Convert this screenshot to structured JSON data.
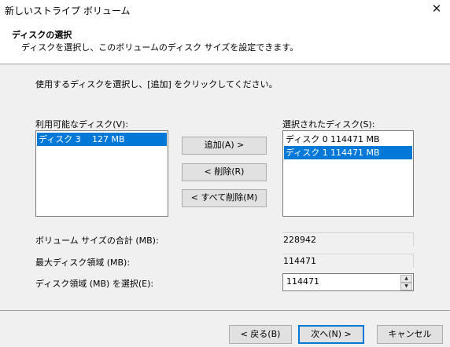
{
  "window": {
    "title": "新しいストライプ ボリューム",
    "close_glyph": "✕"
  },
  "header": {
    "title": "ディスクの選択",
    "subtitle": "ディスクを選択し、このボリュームのディスク サイズを設定できます。"
  },
  "instruction": "使用するディスクを選択し、[追加] をクリックしてください。",
  "available": {
    "label": "利用可能なディスク(V):",
    "items": [
      {
        "name": "ディスク 3",
        "size": "127 MB",
        "selected": true
      }
    ]
  },
  "selected_disks": {
    "label": "選択されたディスク(S):",
    "items": [
      {
        "name": "ディスク 0",
        "size": "114471 MB",
        "selected": false
      },
      {
        "name": "ディスク 1",
        "size": "114471 MB",
        "selected": true
      }
    ]
  },
  "buttons": {
    "add": "追加(A) >",
    "remove": "< 削除(R)",
    "remove_all": "< すべて削除(M)"
  },
  "fields": {
    "total_label": "ボリューム サイズの合計 (MB):",
    "total_value": "228942",
    "max_label": "最大ディスク領域 (MB):",
    "max_value": "114471",
    "select_label": "ディスク領域 (MB) を選択(E):",
    "select_value": "114471",
    "spin_up_glyph": "▲",
    "spin_down_glyph": "▼"
  },
  "footer": {
    "back": "< 戻る(B)",
    "next": "次へ(N) >",
    "cancel": "キャンセル"
  },
  "colors": {
    "selection": "#0078d7",
    "dialog_bg": "#f0f0f0",
    "header_bg": "#ffffff"
  }
}
